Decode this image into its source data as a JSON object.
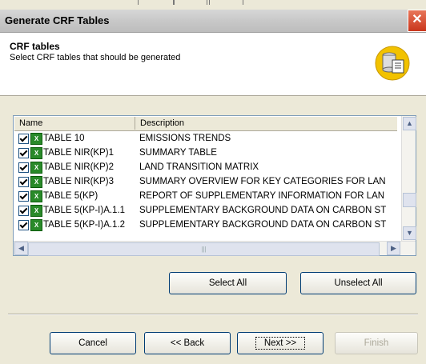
{
  "window": {
    "title": "Generate CRF Tables",
    "close_symbol": "✕"
  },
  "header": {
    "heading": "CRF tables",
    "subtitle": "Select CRF tables that should be generated"
  },
  "list": {
    "columns": [
      "Name",
      "Description"
    ],
    "rows": [
      {
        "name": "TABLE 10",
        "desc": "EMISSIONS TRENDS",
        "checked": true
      },
      {
        "name": "TABLE NIR(KP)1",
        "desc": "SUMMARY TABLE",
        "checked": true
      },
      {
        "name": "TABLE NIR(KP)2",
        "desc": "LAND TRANSITION MATRIX",
        "checked": true
      },
      {
        "name": "TABLE NIR(KP)3",
        "desc": "SUMMARY OVERVIEW FOR KEY CATEGORIES FOR LAN",
        "checked": true
      },
      {
        "name": "TABLE 5(KP)",
        "desc": "REPORT OF SUPPLEMENTARY INFORMATION FOR LAN",
        "checked": true
      },
      {
        "name": "TABLE 5(KP-I)A.1.1",
        "desc": "SUPPLEMENTARY BACKGROUND DATA ON CARBON ST",
        "checked": true
      },
      {
        "name": "TABLE 5(KP-I)A.1.2",
        "desc": "SUPPLEMENTARY BACKGROUND DATA ON CARBON ST",
        "checked": true
      }
    ]
  },
  "buttons": {
    "select_all": "Select All",
    "unselect_all": "Unselect All",
    "cancel": "Cancel",
    "back": "<< Back",
    "next": "Next >>",
    "finish": "Finish"
  },
  "colors": {
    "dialog_bg": "#ece9d8",
    "title_bar": "#c8c8c8",
    "close_button": "#c9361c",
    "excel_icon": "#2a8a2a"
  }
}
